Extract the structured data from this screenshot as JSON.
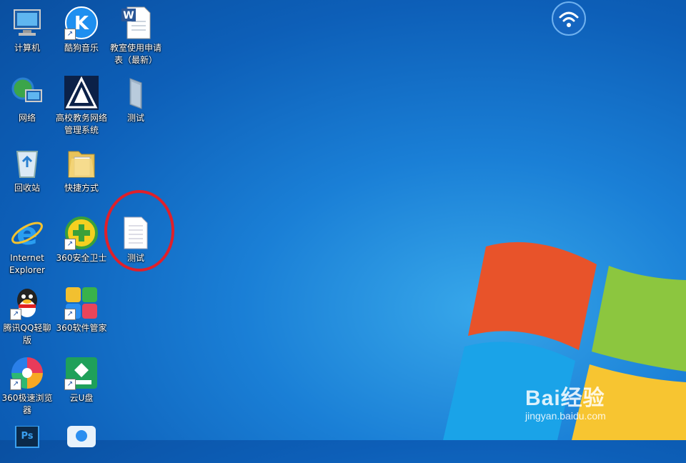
{
  "desktop": {
    "icons": [
      {
        "label": "计算机",
        "icon": "computer-icon",
        "shortcut": false
      },
      {
        "label": "酷狗音乐",
        "icon": "kugou-music-icon",
        "shortcut": true
      },
      {
        "label": "教室使用申请表（最新）",
        "icon": "word-document-icon",
        "shortcut": false
      },
      {
        "label": "网络",
        "icon": "network-icon",
        "shortcut": false
      },
      {
        "label": "高校教务网络管理系统",
        "icon": "academic-system-icon",
        "shortcut": false
      },
      {
        "label": "测试",
        "icon": "folder-icon",
        "shortcut": false
      },
      {
        "label": "回收站",
        "icon": "recycle-bin-icon",
        "shortcut": false
      },
      {
        "label": "快捷方式",
        "icon": "folder-shortcut-icon",
        "shortcut": false
      },
      {
        "label": "Internet Explorer",
        "icon": "internet-explorer-icon",
        "shortcut": false
      },
      {
        "label": "360安全卫士",
        "icon": "360-safe-icon",
        "shortcut": true
      },
      {
        "label": "测试",
        "icon": "text-file-icon",
        "shortcut": false
      },
      {
        "label": "腾讯QQ轻聊版",
        "icon": "qq-icon",
        "shortcut": true
      },
      {
        "label": "360软件管家",
        "icon": "360-software-manager-icon",
        "shortcut": true
      },
      {
        "label": "360极速浏览器",
        "icon": "360-browser-icon",
        "shortcut": true
      },
      {
        "label": "云U盘",
        "icon": "cloud-usb-icon",
        "shortcut": true
      },
      {
        "label": "",
        "icon": "photoshop-icon",
        "shortcut": false
      },
      {
        "label": "",
        "icon": "app-icon",
        "shortcut": false
      }
    ]
  },
  "wifi": {
    "icon": "wifi-icon"
  },
  "highlight": {
    "color": "#e0202a"
  },
  "watermark": {
    "main": "Bai经验",
    "url": "jingyan.baidu.com"
  },
  "colors": {
    "background": "#1a7fd6",
    "logo_red": "#e8532a",
    "logo_green": "#8cc63f",
    "logo_blue": "#1aa3e8",
    "logo_yellow": "#f7c531"
  }
}
